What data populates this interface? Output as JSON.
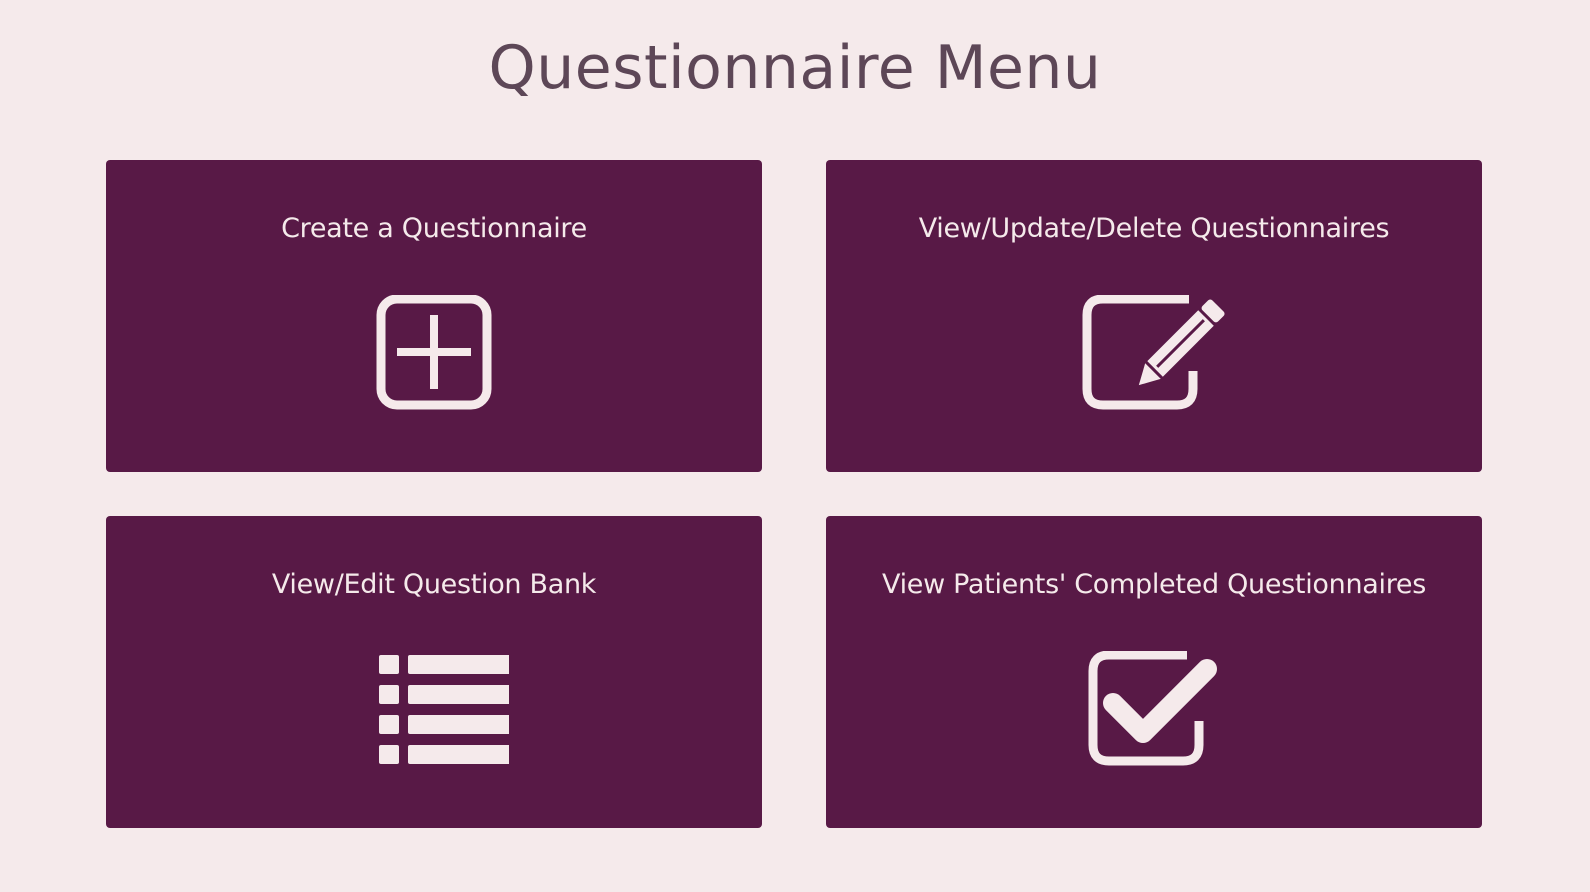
{
  "page": {
    "title": "Questionnaire Menu"
  },
  "colors": {
    "background": "#f5eaeb",
    "card": "#581946",
    "card_text": "#f5eaeb",
    "title_text": "#5d4757"
  },
  "cards": [
    {
      "label": "Create a Questionnaire",
      "icon": "plus-square-icon"
    },
    {
      "label": "View/Update/Delete Questionnaires",
      "icon": "edit-pencil-icon"
    },
    {
      "label": "View/Edit Question Bank",
      "icon": "list-icon"
    },
    {
      "label": "View Patients' Completed Questionnaires",
      "icon": "check-square-icon"
    }
  ]
}
